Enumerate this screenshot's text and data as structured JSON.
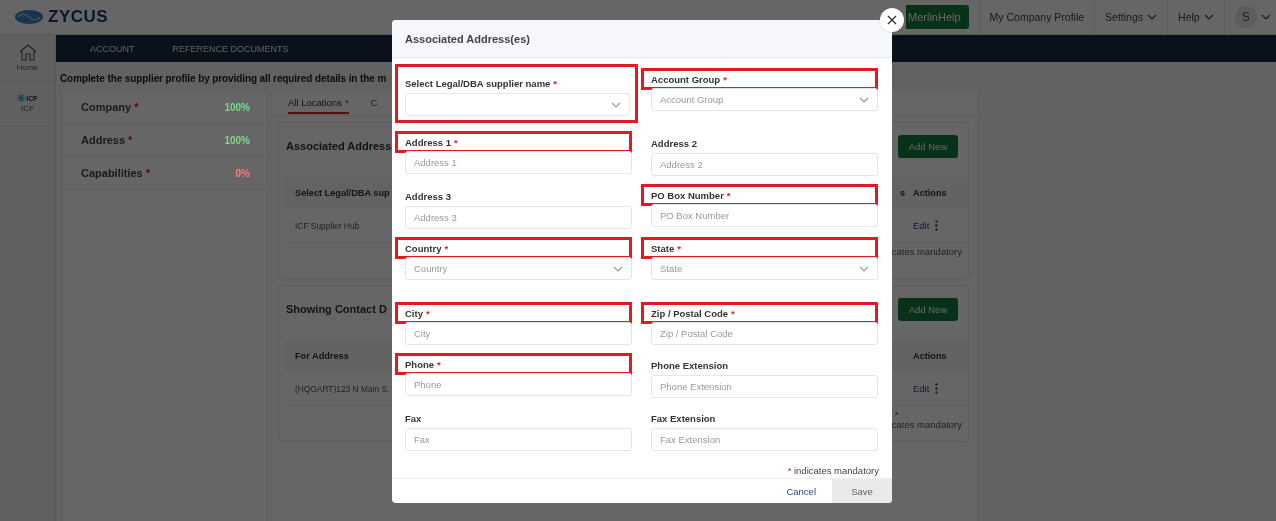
{
  "header": {
    "logo": "ZYCUS",
    "merlin_help": "MerlinHelp",
    "menu": [
      {
        "label": "My Company Profile",
        "dropdown": false
      },
      {
        "label": "Settings",
        "dropdown": true
      },
      {
        "label": "Help",
        "dropdown": true
      }
    ],
    "avatar": "S"
  },
  "rail": [
    {
      "label": "Home"
    },
    {
      "label": "ICF",
      "logo_text": "ICF"
    }
  ],
  "nav_tabs": [
    {
      "label": "ACCOUNT"
    },
    {
      "label": "REFERENCE DOCUMENTS"
    }
  ],
  "intro": "Complete the supplier profile by providing all required details in the m",
  "sections": [
    {
      "label": "Company",
      "required": true,
      "percent": "100%",
      "color": "#7fd68f"
    },
    {
      "label": "Address",
      "required": true,
      "percent": "100%",
      "color": "#7fd68f"
    },
    {
      "label": "Capabilities",
      "required": true,
      "percent": "0%",
      "color": "#ff7a7a"
    }
  ],
  "location_tabs": [
    {
      "label": "All Locations",
      "required": true,
      "selected": true
    },
    {
      "label": "C",
      "required": false,
      "selected": false
    }
  ],
  "cards": [
    {
      "title": "Associated Address",
      "button": "Add New",
      "header": {
        "first": "Select Legal/DBA sup",
        "fragment": "s",
        "actions": "Actions"
      },
      "rows": [
        {
          "first": "ICF Supplier Hub",
          "action": "Edit"
        }
      ],
      "note": "cates mandatory"
    },
    {
      "title": "Showing Contact D",
      "button": "Add New",
      "header": {
        "first": "For Address",
        "actions": "Actions"
      },
      "rows": [
        {
          "first": "(HQOART)123 N Main S.",
          "action": "Edit"
        }
      ],
      "note_star": "*",
      "note": "cates mandatory"
    }
  ],
  "modal": {
    "title": "Associated Address(es)",
    "fields": [
      {
        "label": "Select Legal/DBA supplier name",
        "required": true,
        "kind": "select",
        "label_framed": true,
        "control_framed": true
      },
      {
        "label": "Account Group",
        "required": true,
        "kind": "select",
        "placeholder": "Account Group",
        "label_framed": true,
        "control_framed": false
      },
      {
        "label": "Address 1",
        "required": true,
        "kind": "input",
        "placeholder": "Address 1",
        "label_framed": true,
        "control_framed": false
      },
      {
        "label": "Address 2",
        "required": false,
        "kind": "input",
        "placeholder": "Address 2",
        "label_framed": false,
        "control_framed": false
      },
      {
        "label": "Address 3",
        "required": false,
        "kind": "input",
        "placeholder": "Address 3",
        "label_framed": false,
        "control_framed": false
      },
      {
        "label": "PO Box Number",
        "required": true,
        "kind": "input",
        "placeholder": "PO Box Number",
        "label_framed": true,
        "control_framed": false
      },
      {
        "label": "Country",
        "required": true,
        "kind": "select",
        "placeholder": "Country",
        "label_framed": true,
        "control_framed": false
      },
      {
        "label": "State",
        "required": true,
        "kind": "select",
        "placeholder": "State",
        "label_framed": true,
        "control_framed": false
      },
      {
        "label": "City",
        "required": true,
        "kind": "input",
        "placeholder": "City",
        "label_framed": true,
        "control_framed": false
      },
      {
        "label": "Zip / Postal Code",
        "required": true,
        "kind": "input",
        "placeholder": "Zip / Postal Code",
        "label_framed": true,
        "control_framed": false
      },
      {
        "label": "Phone",
        "required": true,
        "kind": "input",
        "placeholder": "Phone",
        "label_framed": true,
        "control_framed": false
      },
      {
        "label": "Phone Extension",
        "required": false,
        "kind": "input",
        "placeholder": "Phone Extension",
        "label_framed": false,
        "control_framed": false
      },
      {
        "label": "Fax",
        "required": false,
        "kind": "input",
        "placeholder": "Fax",
        "label_framed": false,
        "control_framed": false
      },
      {
        "label": "Fax Extension",
        "required": false,
        "kind": "input",
        "placeholder": "Fax Extension",
        "label_framed": false,
        "control_framed": false
      }
    ],
    "note_star": "*",
    "note": "indicates mandatory",
    "cancel": "Cancel",
    "save": "Save"
  }
}
